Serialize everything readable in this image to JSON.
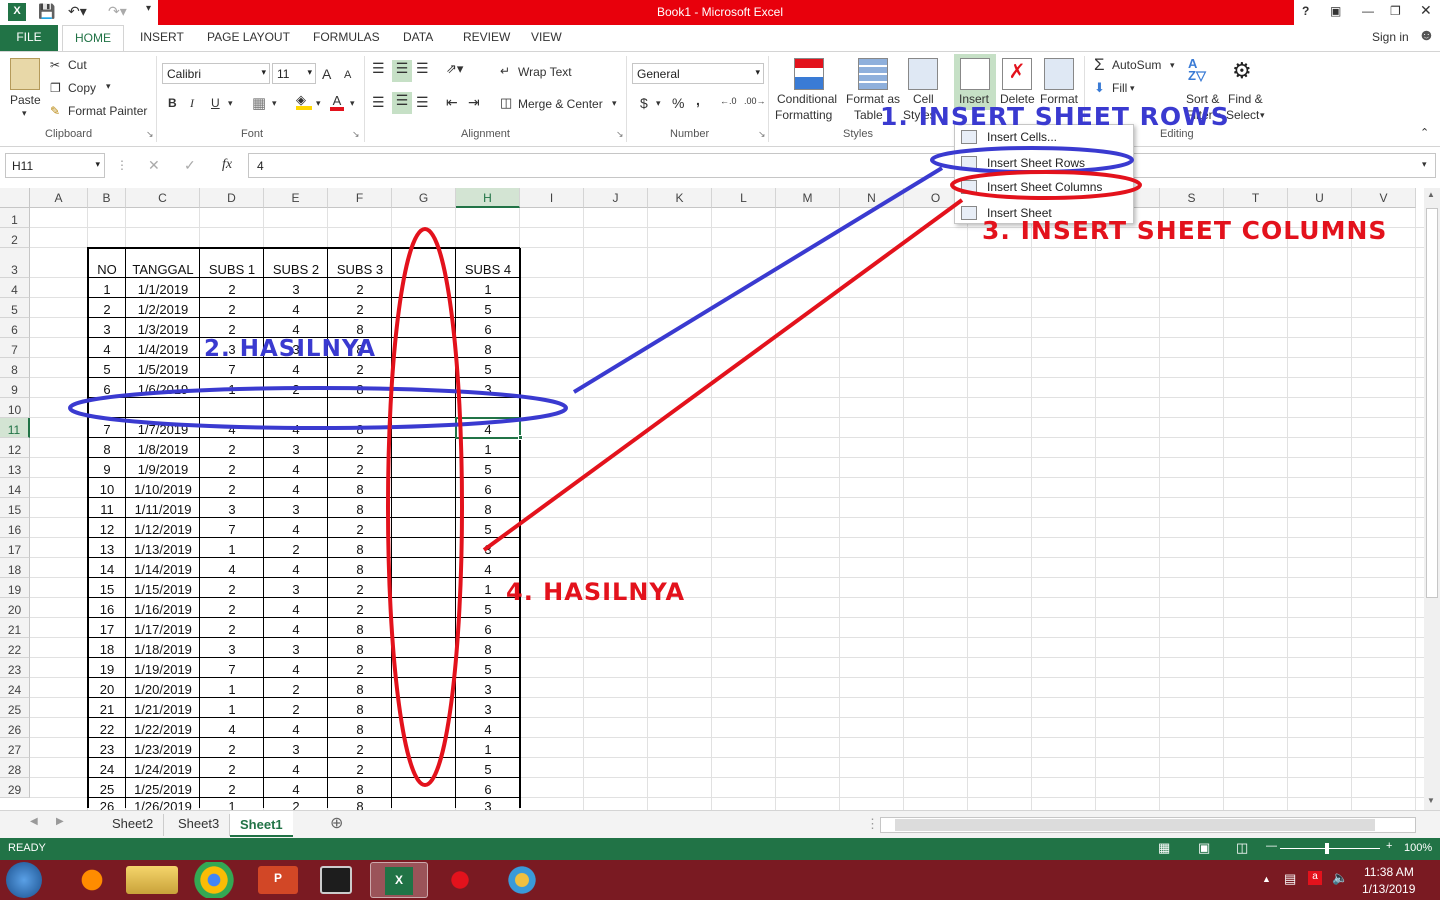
{
  "window": {
    "title": "Book1 - Microsoft Excel",
    "help": "?",
    "signin": "Sign in"
  },
  "tabs": [
    "FILE",
    "HOME",
    "INSERT",
    "PAGE LAYOUT",
    "FORMULAS",
    "DATA",
    "REVIEW",
    "VIEW"
  ],
  "clipboard": {
    "paste": "Paste",
    "cut": "Cut",
    "copy": "Copy",
    "format_painter": "Format Painter",
    "label": "Clipboard"
  },
  "font": {
    "name": "Calibri",
    "size": "11",
    "label": "Font",
    "bold": "B",
    "italic": "I",
    "underline": "U",
    "grow": "A",
    "shrink": "A"
  },
  "alignment": {
    "wrap": "Wrap Text",
    "merge": "Merge & Center",
    "label": "Alignment"
  },
  "number": {
    "format": "General",
    "currency": "$",
    "percent": "%",
    "comma": ",",
    "label": "Number"
  },
  "styles": {
    "conditional": "Conditional",
    "formatting": "Formatting",
    "format_as": "Format as",
    "table": "Table",
    "cell": "Cell",
    "styles": "Styles",
    "label": "Styles"
  },
  "cells": {
    "insert": "Insert",
    "delete": "Delete",
    "format": "Format"
  },
  "editing": {
    "autosum": "AutoSum",
    "fill": "Fill",
    "sort": "Sort &",
    "filter": "Filter",
    "find": "Find &",
    "select": "Select",
    "label": "Editing"
  },
  "formula_bar": {
    "name_box": "H11",
    "fx": "fx",
    "value": "4"
  },
  "insert_menu": {
    "items": [
      "Insert Cells...",
      "Insert Sheet Rows",
      "Insert Sheet Columns",
      "Insert Sheet"
    ]
  },
  "columns": [
    "A",
    "B",
    "C",
    "D",
    "E",
    "F",
    "G",
    "H",
    "I",
    "J",
    "K",
    "L",
    "M",
    "N",
    "O",
    "P",
    "Q",
    "R",
    "S",
    "T",
    "U",
    "V"
  ],
  "rows": [
    "1",
    "2",
    "3",
    "4",
    "5",
    "6",
    "7",
    "8",
    "9",
    "10",
    "11",
    "12",
    "13",
    "14",
    "15",
    "16",
    "17",
    "18",
    "19",
    "20",
    "21",
    "22",
    "23",
    "24",
    "25",
    "26",
    "27",
    "28",
    "29"
  ],
  "table": {
    "headers": [
      "NO",
      "TANGGAL",
      "SUBS 1",
      "SUBS 2",
      "SUBS 3",
      "SUBS 4"
    ],
    "rows": [
      [
        "1",
        "1/1/2019",
        "2",
        "3",
        "2",
        "1"
      ],
      [
        "2",
        "1/2/2019",
        "2",
        "4",
        "2",
        "5"
      ],
      [
        "3",
        "1/3/2019",
        "2",
        "4",
        "8",
        "6"
      ],
      [
        "4",
        "1/4/2019",
        "3",
        "3",
        "8",
        "8"
      ],
      [
        "5",
        "1/5/2019",
        "7",
        "4",
        "2",
        "5"
      ],
      [
        "6",
        "1/6/2019",
        "1",
        "2",
        "8",
        "3"
      ],
      [
        "",
        "",
        "",
        "",
        "",
        ""
      ],
      [
        "7",
        "1/7/2019",
        "4",
        "4",
        "8",
        "4"
      ],
      [
        "8",
        "1/8/2019",
        "2",
        "3",
        "2",
        "1"
      ],
      [
        "9",
        "1/9/2019",
        "2",
        "4",
        "2",
        "5"
      ],
      [
        "10",
        "1/10/2019",
        "2",
        "4",
        "8",
        "6"
      ],
      [
        "11",
        "1/11/2019",
        "3",
        "3",
        "8",
        "8"
      ],
      [
        "12",
        "1/12/2019",
        "7",
        "4",
        "2",
        "5"
      ],
      [
        "13",
        "1/13/2019",
        "1",
        "2",
        "8",
        "3"
      ],
      [
        "14",
        "1/14/2019",
        "4",
        "4",
        "8",
        "4"
      ],
      [
        "15",
        "1/15/2019",
        "2",
        "3",
        "2",
        "1"
      ],
      [
        "16",
        "1/16/2019",
        "2",
        "4",
        "2",
        "5"
      ],
      [
        "17",
        "1/17/2019",
        "2",
        "4",
        "8",
        "6"
      ],
      [
        "18",
        "1/18/2019",
        "3",
        "3",
        "8",
        "8"
      ],
      [
        "19",
        "1/19/2019",
        "7",
        "4",
        "2",
        "5"
      ],
      [
        "20",
        "1/20/2019",
        "1",
        "2",
        "8",
        "3"
      ],
      [
        "21",
        "1/21/2019",
        "1",
        "2",
        "8",
        "3"
      ],
      [
        "22",
        "1/22/2019",
        "4",
        "4",
        "8",
        "4"
      ],
      [
        "23",
        "1/23/2019",
        "2",
        "3",
        "2",
        "1"
      ],
      [
        "24",
        "1/24/2019",
        "2",
        "4",
        "2",
        "5"
      ],
      [
        "25",
        "1/25/2019",
        "2",
        "4",
        "8",
        "6"
      ],
      [
        "26",
        "1/26/2019",
        "1",
        "2",
        "8",
        "3"
      ]
    ]
  },
  "annotations": {
    "a1": "1. INSERT SHEET ROWS",
    "a2": "2. HASILNYA",
    "a3": "3. INSERT SHEET COLUMNS",
    "a4": "4. HASILNYA"
  },
  "sheet_tabs": [
    "Sheet2",
    "Sheet3",
    "Sheet1"
  ],
  "status": {
    "ready": "READY",
    "zoom": "100%"
  },
  "clock": {
    "time": "11:38 AM",
    "date": "1/13/2019"
  },
  "colors": {
    "excel_green": "#217346",
    "title_red": "#e8000c",
    "annot_blue": "#3a3ad0",
    "annot_red": "#e3121c"
  }
}
